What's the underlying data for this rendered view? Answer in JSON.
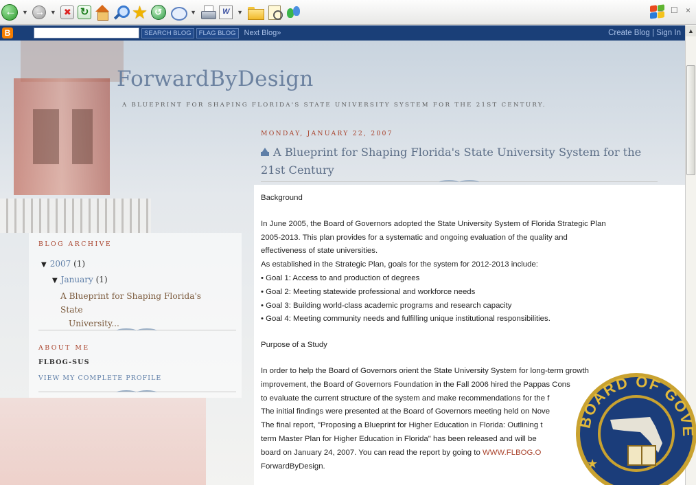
{
  "browser": {
    "toolbar_icons": [
      "back-icon",
      "forward-icon",
      "stop-icon",
      "refresh-icon",
      "home-icon",
      "search-icon",
      "favorites-star-icon",
      "history-icon",
      "mail-icon",
      "print-icon",
      "edit-icon",
      "folder-icon",
      "research-icon",
      "messenger-icon",
      "windows-logo-icon"
    ],
    "window_controls": "– ☐ ×"
  },
  "navbar": {
    "logo": "B",
    "search_button": "SEARCH BLOG",
    "flag_button": "FLAG BLOG",
    "next_blog": "Next Blog»",
    "right_links": "Create Blog | Sign In"
  },
  "header": {
    "title": "ForwardByDesign",
    "description": "A BLUEPRINT FOR SHAPING FLORIDA'S STATE UNIVERSITY SYSTEM FOR THE 21ST CENTURY."
  },
  "post": {
    "date": "MONDAY, JANUARY 22, 2007",
    "title": "A Blueprint for Shaping Florida's State University System for the 21st Century",
    "section1_heading": "Background",
    "para1_lines": [
      "In June 2005, the Board of Governors adopted the State University System of Florida Strategic Plan",
      "2005-2013. This plan provides for a systematic and ongoing evaluation of the quality and",
      "effectiveness of state universities.",
      "As established in the Strategic Plan, goals for the system for 2012-2013 include:",
      "• Goal 1: Access to and production of degrees",
      "• Goal 2: Meeting statewide professional and workforce needs",
      "• Goal 3: Building world-class academic programs and research capacity",
      "• Goal 4: Meeting community needs and fulfilling unique institutional responsibilities."
    ],
    "section2_heading": "Purpose of a Study",
    "para2_lines": [
      "In order to help the Board of Governors orient the State University System for long-term growth",
      "improvement, the Board of Governors Foundation in the Fall 2006 hired the Pappas Cons",
      "to evaluate the current structure of the system and make recommendations for the f",
      "The initial findings were presented at the Board of Governors meeting held on Nove",
      "The final report, \"Proposing a Blueprint for Higher Education in Florida: Outlining t",
      "term Master Plan for Higher Education in Florida\" has been released and will be",
      "board on January 24, 2007. You can read the report by going to"
    ],
    "report_link": "WWW.FLBOG.O",
    "last_line": "ForwardByDesign."
  },
  "sidebar": {
    "archive_heading": "BLOG ARCHIVE",
    "year_label": "2007",
    "year_count": "(1)",
    "month_label": "January",
    "month_count": "(1)",
    "post_link_line1": "A Blueprint for Shaping Florida's State",
    "post_link_line2": "University...",
    "about_heading": "ABOUT ME",
    "profile_name": "FLBOG-SUS",
    "profile_link": "VIEW MY COMPLETE PROFILE"
  },
  "seal": {
    "text": "BOARD OF GOVE"
  }
}
